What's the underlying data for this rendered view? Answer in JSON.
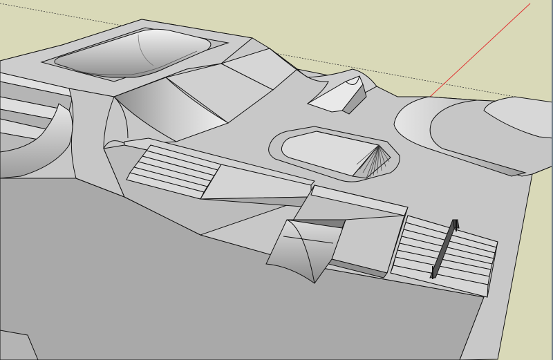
{
  "app": {
    "kind": "3D modeling viewport",
    "background_color": "#d9d9b8",
    "ground_color": "#a9a9a9",
    "surface_color": "#c8c8c8",
    "edge_color": "#111111",
    "red_axis_color": "#e03030",
    "view": "perspective"
  },
  "scene": {
    "subject": "skatepark model",
    "visible_features": [
      "bowl",
      "quarter-pipe",
      "funbox",
      "stairs",
      "handrail",
      "kicker-ramp",
      "hip-ramp"
    ]
  }
}
